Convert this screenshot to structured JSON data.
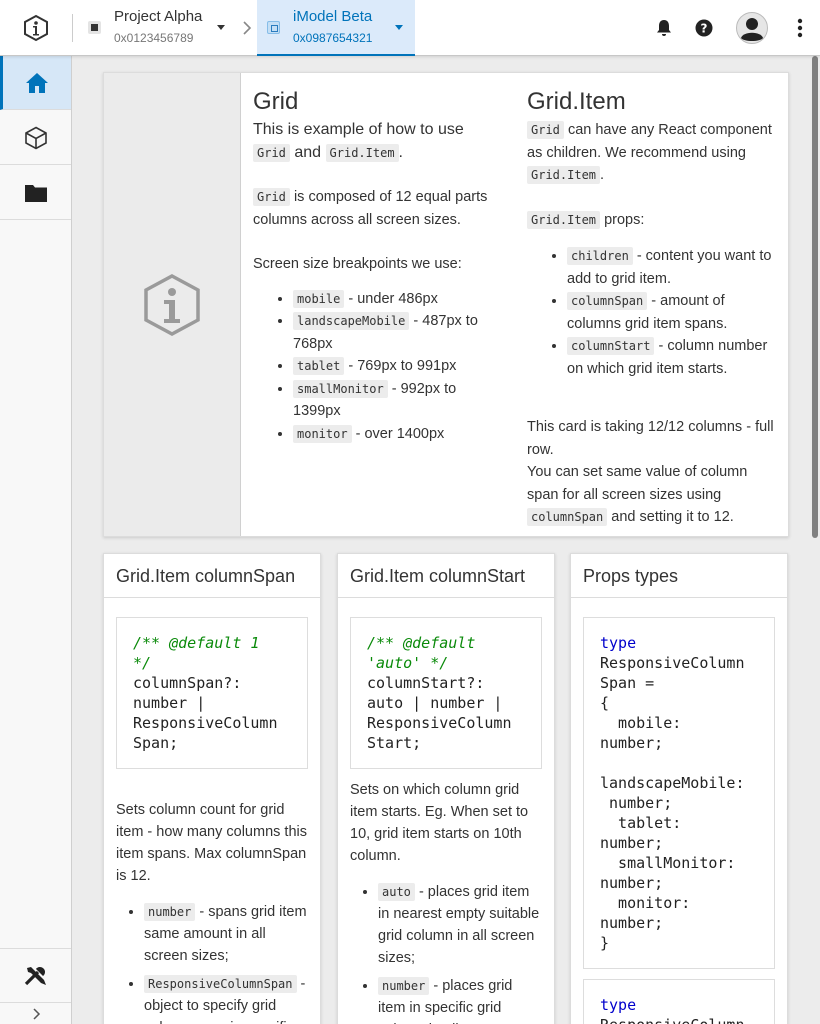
{
  "header": {
    "project": {
      "title": "Project Alpha",
      "id": "0x0123456789"
    },
    "imodel": {
      "title": "iModel Beta",
      "id": "0x0987654321"
    }
  },
  "hero": {
    "grid": {
      "title": "Grid",
      "intro_a": "This is example of how to use",
      "code_grid": "Grid",
      "and": "and",
      "code_item": "Grid.Item",
      "period": ".",
      "p2_code": "Grid",
      "p2_text": "is composed of 12 equal parts columns across all screen sizes.",
      "p3": "Screen size breakpoints we use:",
      "breakpoints": [
        {
          "code": "mobile",
          "text": "- under 486px"
        },
        {
          "code": "landscapeMobile",
          "text": "- 487px to 768px"
        },
        {
          "code": "tablet",
          "text": "- 769px to 991px"
        },
        {
          "code": "smallMonitor",
          "text": "- 992px to 1399px"
        },
        {
          "code": "monitor",
          "text": "- over 1400px"
        }
      ]
    },
    "item": {
      "title": "Grid.Item",
      "p1_code": "Grid",
      "p1_text": "can have any React component as children. We recommend using",
      "p1_code2": "Grid.Item",
      "p1_end": ".",
      "props_code": "Grid.Item",
      "props_text": "props:",
      "props": [
        {
          "code": "children",
          "text": "- content you want to add to grid item."
        },
        {
          "code": "columnSpan",
          "text": "- amount of columns grid item spans."
        },
        {
          "code": "columnStart",
          "text": "- column number on which grid item starts."
        }
      ],
      "note1": "This card is taking 12/12 columns - full row.",
      "note2": "You can set same value of column span for all screen sizes using",
      "note2_code": "columnSpan",
      "note2_end": "and setting it to 12."
    }
  },
  "cards": {
    "span": {
      "title": "Grid.Item columnSpan",
      "code_comment1": "/** @default 1",
      "code_comment2": "*/",
      "code_rest": "columnSpan?:\nnumber |\nResponsiveColumn\nSpan;",
      "desc": "Sets column count for grid item - how many columns this item spans. Max columnSpan is 12.",
      "items": [
        {
          "code": "number",
          "text": "- spans grid item same amount in all screen sizes;"
        },
        {
          "code": "ResponsiveColumnSpan",
          "text": "- object to specify grid column span in specific"
        }
      ]
    },
    "start": {
      "title": "Grid.Item columnStart",
      "code_comment1": "/** @default",
      "code_comment2": "'auto' */",
      "code_rest": "columnStart?:\nauto | number |\nResponsiveColumn\nStart;",
      "desc": "Sets on which column grid item starts. Eg. When set to 10, grid item starts on 10th column.",
      "items": [
        {
          "code": "auto",
          "text": "- places grid item in nearest empty suitable grid column in all screen sizes;"
        },
        {
          "code": "number",
          "text": "- places grid item in specific grid column in all screen"
        }
      ]
    },
    "types": {
      "title": "Props types",
      "code1_kw": "type",
      "code1_rest": "ResponsiveColumn\nSpan =\n{\n  mobile:\nnumber;\n\nlandscapeMobile:\n number;\n  tablet:\nnumber;\n  smallMonitor:\nnumber;\n  monitor:\nnumber;\n}",
      "code2_kw": "type",
      "code2_rest": "ResponsiveColumn"
    }
  },
  "colors": {
    "accent": "#0073ba",
    "active_bg": "#d6e7f7",
    "comment": "#0a8a0a",
    "keyword": "#0000cc"
  }
}
